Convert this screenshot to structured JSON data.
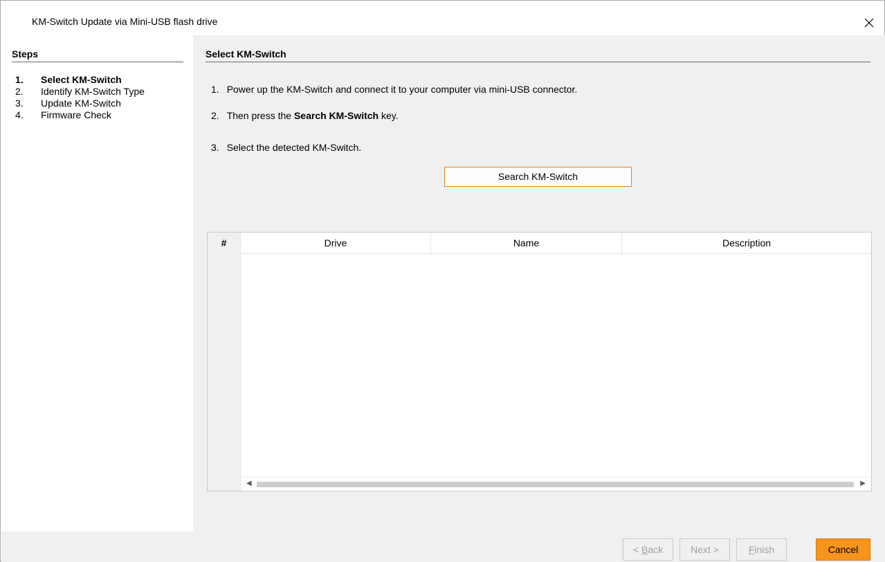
{
  "window": {
    "title": "KM-Switch Update via Mini-USB flash drive"
  },
  "steps": {
    "header": "Steps",
    "items": [
      {
        "num": "1.",
        "label": "Select KM-Switch"
      },
      {
        "num": "2.",
        "label": "Identify KM-Switch Type"
      },
      {
        "num": "3.",
        "label": "Update KM-Switch"
      },
      {
        "num": "4.",
        "label": "Firmware Check"
      }
    ]
  },
  "content": {
    "header": "Select KM-Switch",
    "instructions": [
      {
        "num": "1.",
        "text": "Power up the KM-Switch and connect it to your computer via mini-USB connector."
      },
      {
        "num": "2.",
        "pre": "Then press the ",
        "bold": "Search KM-Switch",
        "post": " key."
      },
      {
        "num": "3.",
        "text": "Select the detected KM-Switch."
      }
    ],
    "search_button": "Search KM-Switch",
    "table": {
      "columns": [
        "#",
        "Drive",
        "Name",
        "Description"
      ],
      "rows": []
    }
  },
  "buttons": {
    "back": {
      "pre": "< ",
      "mnemonic": "B",
      "post": "ack"
    },
    "next": "Next >",
    "finish": {
      "mnemonic": "F",
      "post": "inish"
    },
    "cancel": "Cancel"
  },
  "colors": {
    "accent": "#f7941d",
    "accent_border": "#e8821e",
    "panel_bg": "#f0f0f0"
  }
}
